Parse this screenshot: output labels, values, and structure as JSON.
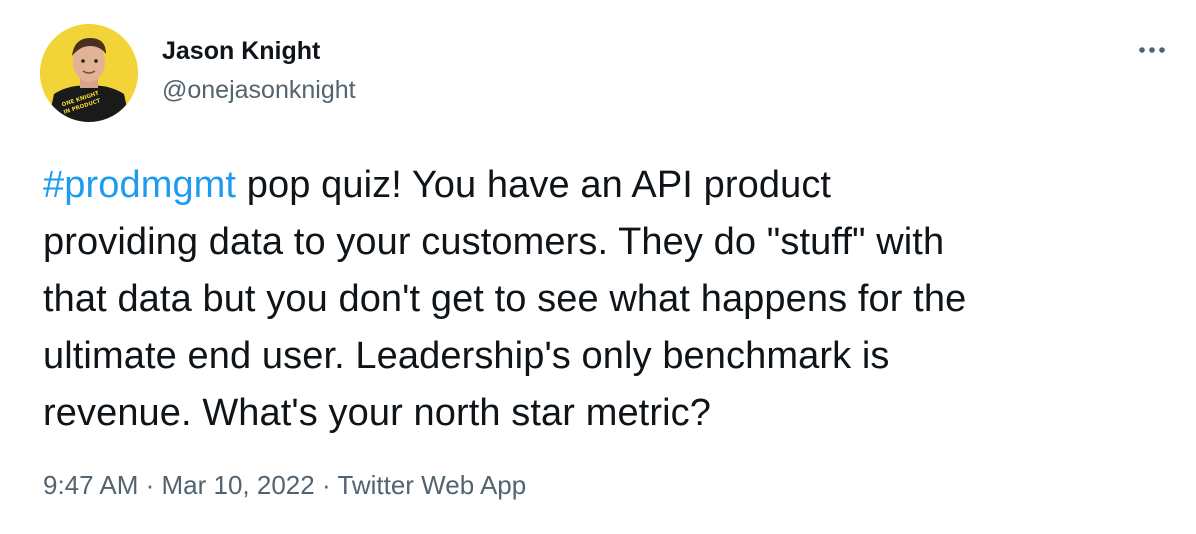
{
  "author": {
    "name": "Jason Knight",
    "handle": "@onejasonknight",
    "avatar_shirt_text": [
      "ONE KNIGHT",
      "IN PRODUCT"
    ]
  },
  "tweet": {
    "hashtag": "#prodmgmt",
    "text_lines": [
      " pop quiz! You have an API product",
      "providing data to your customers. They do \"stuff\" with",
      "that data but you don't get to see what happens for the",
      "ultimate end user. Leadership's only benchmark is",
      "revenue. What's your north star metric?"
    ]
  },
  "meta": {
    "time": "9:47 AM",
    "separator": " · ",
    "date": "Mar 10, 2022",
    "source": "Twitter Web App"
  },
  "icons": {
    "more": "more-horizontal-icon"
  },
  "colors": {
    "link": "#1d9bf0",
    "secondary_text": "#536471",
    "primary_text": "#0f1419",
    "avatar_background": "#f3d438"
  }
}
